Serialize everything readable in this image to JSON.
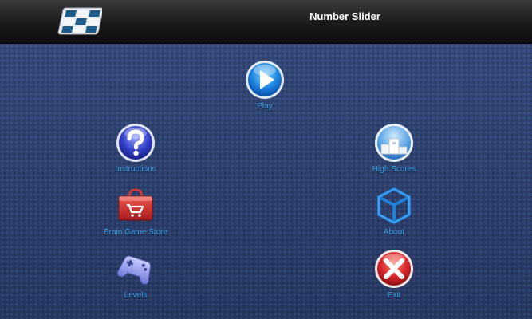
{
  "header": {
    "title": "Number Slider"
  },
  "menu": {
    "play": "Play",
    "instructions": "Instructions",
    "high_scores": "High Scores",
    "store": "Brain Game Store",
    "about": "About",
    "levels": "Levels",
    "exit": "Exit"
  },
  "colors": {
    "background": "#2d4070",
    "header": "#1b1b1b",
    "label": "#3aa0ea",
    "exit_red": "#d9262b"
  },
  "icons": {
    "logo": "tile-puzzle-logo-icon",
    "play": "play-icon",
    "instructions": "question-mark-icon",
    "high_scores": "podium-icon",
    "store": "shopping-basket-icon",
    "about": "cube-icon",
    "levels": "gamepad-icon",
    "exit": "close-x-icon"
  }
}
